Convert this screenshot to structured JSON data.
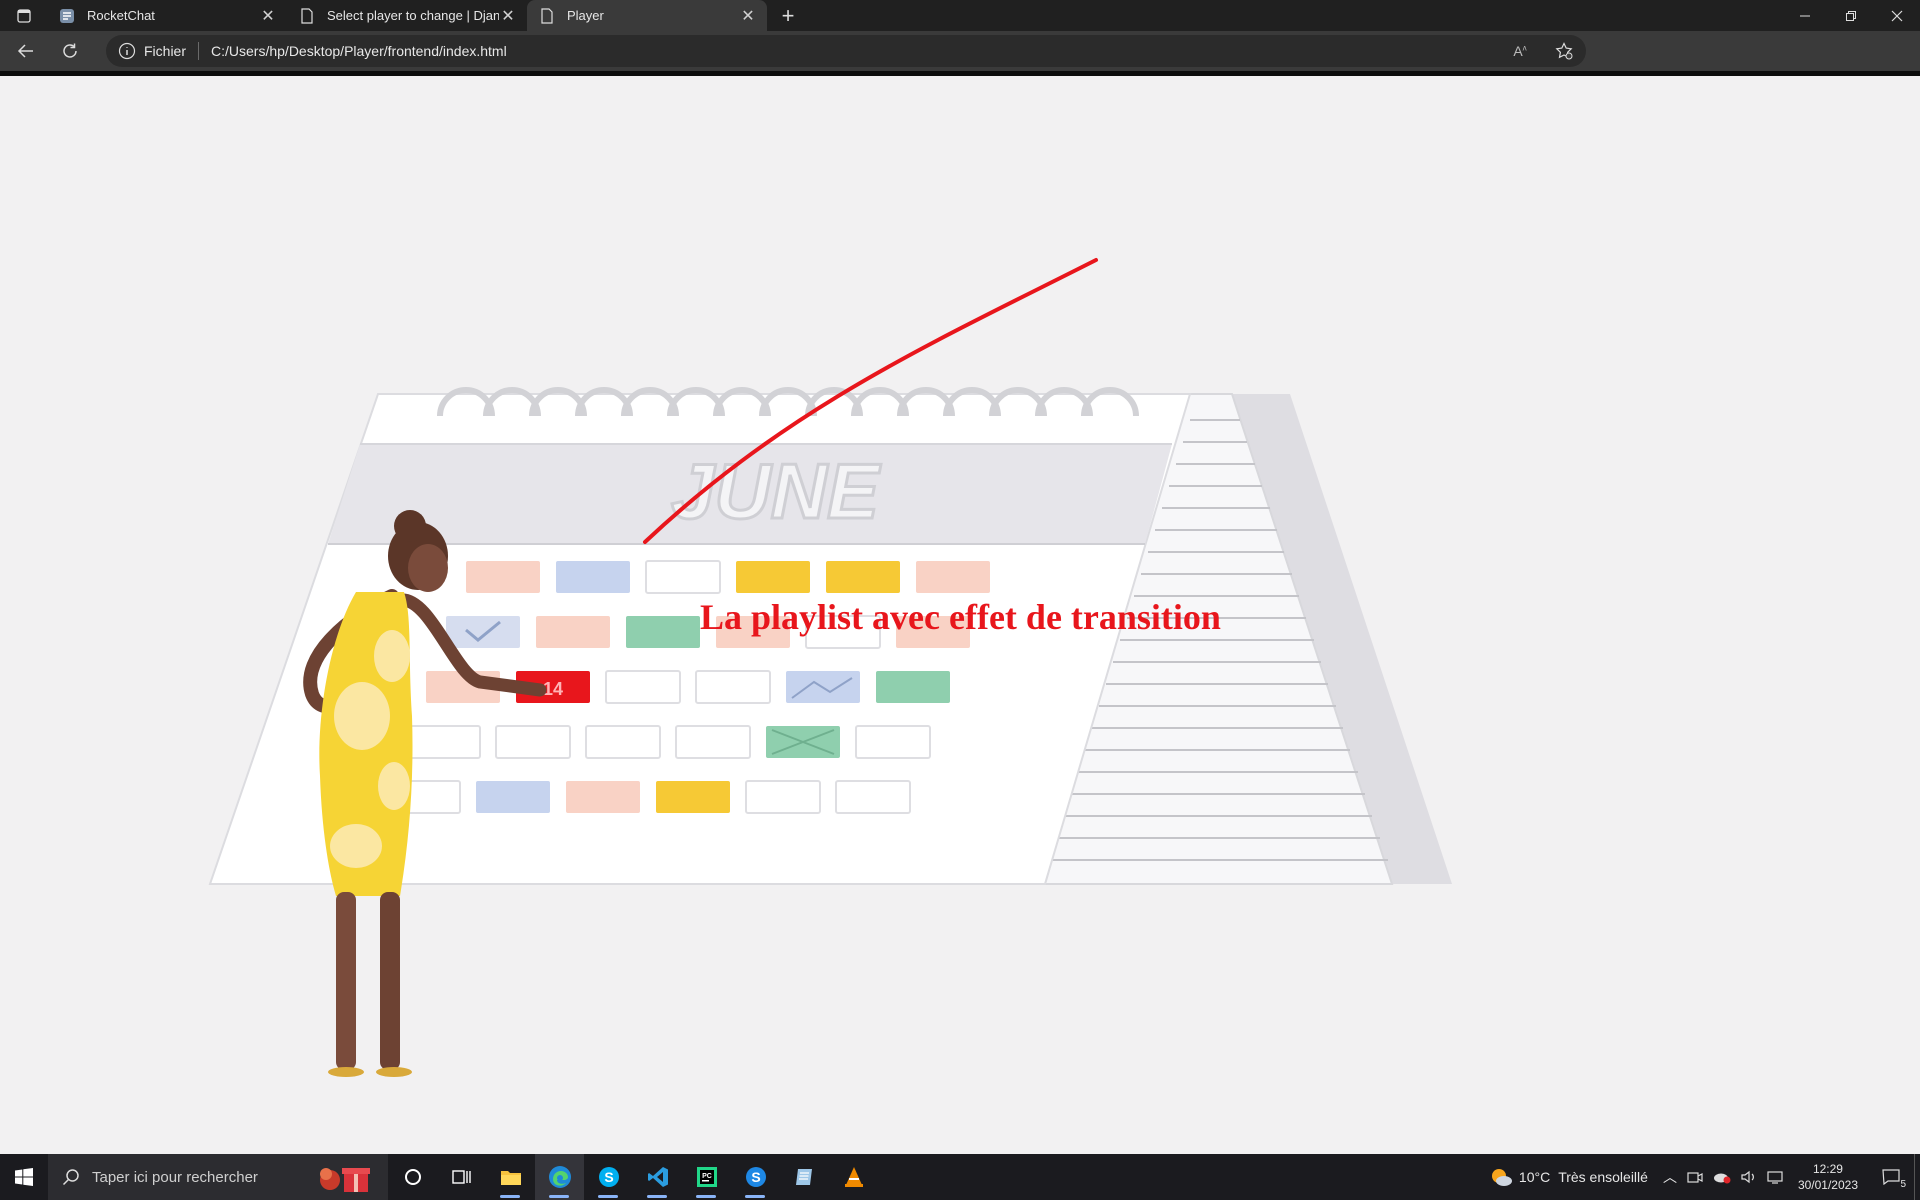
{
  "browser": {
    "tabs": [
      {
        "label": "RocketChat",
        "icon": "rocketchat-icon",
        "active": false
      },
      {
        "label": "Select player to change | Django",
        "icon": "page-icon",
        "active": false
      },
      {
        "label": "Player",
        "icon": "page-icon",
        "active": true
      }
    ],
    "address": {
      "scheme_label": "Fichier",
      "url": "C:/Users/hp/Desktop/Player/frontend/index.html"
    }
  },
  "page": {
    "overlay_title": "La playlist avec effet de transition",
    "video": {
      "calendar_month": "JUNE",
      "highlighted_day": "14"
    }
  },
  "taskbar": {
    "search_placeholder": "Taper ici pour rechercher",
    "apps": [
      "cortana-icon",
      "task-view-icon",
      "file-explorer-icon",
      "edge-icon",
      "skype-icon",
      "vscode-icon",
      "pycharm-icon",
      "skype-icon",
      "notes-icon",
      "vlc-icon"
    ],
    "weather": {
      "temp": "10°C",
      "condition": "Très ensoleillé"
    },
    "clock": {
      "time": "12:29",
      "date": "30/01/2023"
    },
    "notifications": "5"
  },
  "colors": {
    "accent_red": "#e8161c",
    "calendar_yellow": "#f6c935",
    "calendar_green": "#8fcfae",
    "calendar_peach": "#f9d2c5",
    "calendar_blue": "#c6d3ee"
  }
}
